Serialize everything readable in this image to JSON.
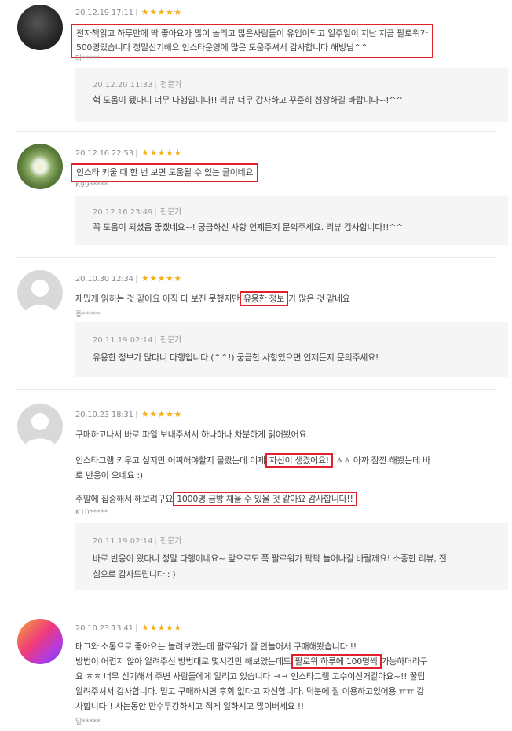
{
  "reviews": [
    {
      "date": "20.12.19 17:11",
      "stars": "★★★★★",
      "lines": [
        "전자책읽고 하루만에 딱 좋아요가 많이 놀리고 많은사람들이 유입이되고 일주일이 지난 지금 팔로워가",
        "500명있습니다 정말신기해요 인스타운영에 많은 도움주셔서 감사합니다 해빙님^^"
      ],
      "user": "다*****",
      "reply": {
        "date": "20.12.20 11:33",
        "tag": "전문가",
        "lines": [
          "헉 도움이 됐다니 너무 다행입니다!! 리뷰 너무 감사하고 꾸준히 성장하길 바랍니다~!^^"
        ]
      }
    },
    {
      "date": "20.12.16 22:53",
      "stars": "★★★★★",
      "lines": [
        "인스타 키울 때 한 번 보면 도움될 수 있는 글이네요"
      ],
      "user": "K99*****",
      "reply": {
        "date": "20.12.16 23:49",
        "tag": "전문가",
        "lines": [
          "꼭 도움이 되셨음 좋겠네요~! 궁금하신 사항 언제든지 문의주세요. 리뷰 감사합니다!!^^"
        ]
      }
    },
    {
      "date": "20.10.30 12:34",
      "stars": "★★★★★",
      "line_a": "재밌게 읽히는 것 같아요 아직 다 보진 못했지만",
      "line_hl": "유용한 정보",
      "line_b": "가 많은 것 같네요",
      "user": "종*****",
      "reply": {
        "date": "20.11.19 02:14",
        "tag": "전문가",
        "lines": [
          "유용한 정보가 많다니 다행입니다 (^^!) 궁금한 사항있으면 언제든지 문의주세요!"
        ]
      }
    },
    {
      "date": "20.10.23 18:31",
      "stars": "★★★★★",
      "p1": "구매하고나서 바로 파일 보내주셔서 하나하나 차분하게 읽어봤어요.",
      "p2a": "인스타그램 키우고 싶지만 어찌해야할지 몰랐는데 이제",
      "p2hl": "자신이 생겼어요!",
      "p2b": "ㅎㅎ 아까 잠깐 해봤는데 바",
      "p2c": "로 반응이 오네요 :)",
      "p3a": "주말에 집중해서 해보려구요",
      "p3hl": "1000명 금방 채울 수 있을 것 같아요 감사합니다!!",
      "user": "K10*****",
      "reply": {
        "date": "20.11.19 02:14",
        "tag": "전문가",
        "lines": [
          "바로 반응이 왔다니 정말 다행이네요~ 앞으로도 쭉 팔로워가 팍팍 늘어나길 바랄께요! 소중한 리뷰, 진",
          "심으로 감사드립니다 : )"
        ]
      }
    },
    {
      "date": "20.10.23 13:41",
      "stars": "★★★★★",
      "l1": "태그와 소통으로 좋아요는 늘려보았는데 팔로워가 잘 안늘어서 구매해봤습니다 !!",
      "l2a": "방법이 어렵지 않아 알려주신 방법대로 몇시간만 해보았는데도",
      "l2hl": "팔로워 하루에 100명씩",
      "l2b": "가능하더라구",
      "l3": "요 ㅎㅎ 너무 신기해서 주변 사람들에게 알리고 있습니다 ㅋㅋ 인스타그램 고수이신거같아요~!! 꿀팁",
      "l4": "알려주셔서 감사합니다. 믿고 구매하시면 후회 없다고 자신합니다. 덕분에 잘 이용하고있어용 ㅠㅠ 감",
      "l5": "사합니다!! 사는동안 만수무강하시고 적게 일하시고 많이버세요 !!",
      "user": "일*****"
    }
  ]
}
